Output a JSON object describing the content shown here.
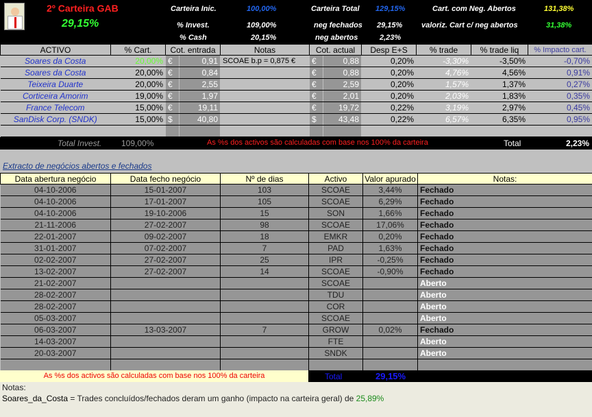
{
  "header": {
    "title": "2º Carteira GAB",
    "return": "29,15%",
    "carteira_inic_label": "Carteira Inic.",
    "carteira_inic": "100,00%",
    "invest_label": "% Invest.",
    "invest": "109,00%",
    "cash_label": "%  Cash",
    "cash": "20,15%",
    "carteira_total_label": "Carteira Total",
    "carteira_total": "129,15%",
    "neg_fechados_label": "neg fechados",
    "neg_fechados": "29,15%",
    "neg_abertos_label": "neg abertos",
    "neg_abertos": "2,23%",
    "cart_neg_abertos_label": "Cart. com Neg. Abertos",
    "cart_neg_abertos": "131,38%",
    "valoriz_label": "valoriz. Cart c/ neg abertos",
    "valoriz": "31,38%"
  },
  "positions": {
    "columns": [
      "ACTIVO",
      "% Cart.",
      "Cot. entrada",
      "Notas",
      "Cot. actual",
      "Desp E+S",
      "% trade",
      "% trade liq",
      "% Impacto cart."
    ],
    "rows": [
      [
        "Soares da Costa",
        "20,00%",
        "€",
        "0,91",
        "SCOAE b.p = 0,875 €",
        "€",
        "0,88",
        "0,20%",
        "-3,30%",
        "-3,50%",
        "-0,70%"
      ],
      [
        "Soares da Costa",
        "20,00%",
        "€",
        "0,84",
        "",
        "€",
        "0,88",
        "0,20%",
        "4,76%",
        "4,56%",
        "0,91%"
      ],
      [
        "Teixeira Duarte",
        "20,00%",
        "€",
        "2,55",
        "",
        "€",
        "2,59",
        "0,20%",
        "1,57%",
        "1,37%",
        "0,27%"
      ],
      [
        "Corticeira Amorim",
        "19,00%",
        "€",
        "1,97",
        "",
        "€",
        "2,01",
        "0,20%",
        "2,03%",
        "1,83%",
        "0,35%"
      ],
      [
        "France Telecom",
        "15,00%",
        "€",
        "19,11",
        "",
        "€",
        "19,72",
        "0,22%",
        "3,19%",
        "2,97%",
        "0,45%"
      ],
      [
        "SanDisk Corp. (SNDK)",
        "15,00%",
        "$",
        "40,80",
        "",
        "$",
        "43,48",
        "0,22%",
        "6,57%",
        "6,35%",
        "0,95%"
      ]
    ],
    "total_invest_label": "Total Invest.",
    "total_invest": "109,00%",
    "note": "As %s dos activos são calculadas com base nos 100% da carteira",
    "total_label": "Total",
    "total": "2,23%"
  },
  "trades": {
    "title": "Extracto de negócios abertos e fechados",
    "columns": [
      "Data abertura negócio",
      "Data fecho negócio",
      "Nº de dias",
      "Activo",
      "Valor apurado",
      "Notas:"
    ],
    "rows": [
      [
        "04-10-2006",
        "15-01-2007",
        "103",
        "SCOAE",
        "3,44%",
        "Fechado"
      ],
      [
        "04-10-2006",
        "17-01-2007",
        "105",
        "SCOAE",
        "6,29%",
        "Fechado"
      ],
      [
        "04-10-2006",
        "19-10-2006",
        "15",
        "SON",
        "1,66%",
        "Fechado"
      ],
      [
        "21-11-2006",
        "27-02-2007",
        "98",
        "SCOAE",
        "17,06%",
        "Fechado"
      ],
      [
        "22-01-2007",
        "09-02-2007",
        "18",
        "EMKR",
        "0,20%",
        "Fechado"
      ],
      [
        "31-01-2007",
        "07-02-2007",
        "7",
        "PAD",
        "1,63%",
        "Fechado"
      ],
      [
        "02-02-2007",
        "27-02-2007",
        "25",
        "IPR",
        "-0,25%",
        "Fechado"
      ],
      [
        "13-02-2007",
        "27-02-2007",
        "14",
        "SCOAE",
        "-0,90%",
        "Fechado"
      ],
      [
        "21-02-2007",
        "",
        "",
        "SCOAE",
        "",
        "Aberto"
      ],
      [
        "28-02-2007",
        "",
        "",
        "TDU",
        "",
        "Aberto"
      ],
      [
        "28-02-2007",
        "",
        "",
        "COR",
        "",
        "Aberto"
      ],
      [
        "05-03-2007",
        "",
        "",
        "SCOAE",
        "",
        "Aberto"
      ],
      [
        "06-03-2007",
        "13-03-2007",
        "7",
        "GROW",
        "0,02%",
        "Fechado"
      ],
      [
        "14-03-2007",
        "",
        "",
        "FTE",
        "",
        "Aberto"
      ],
      [
        "20-03-2007",
        "",
        "",
        "SNDK",
        "",
        "Aberto"
      ]
    ],
    "note": "As %s dos activos são calculadas com base nos 100% da carteira",
    "total_label": "Total",
    "total": "29,15%"
  },
  "notes": {
    "label": "Notas:",
    "name": "Soares_da_Costa",
    "text": " = Trades concluídos/fechados deram um ganho (impacto na carteira geral) de ",
    "value": "25,89%"
  }
}
